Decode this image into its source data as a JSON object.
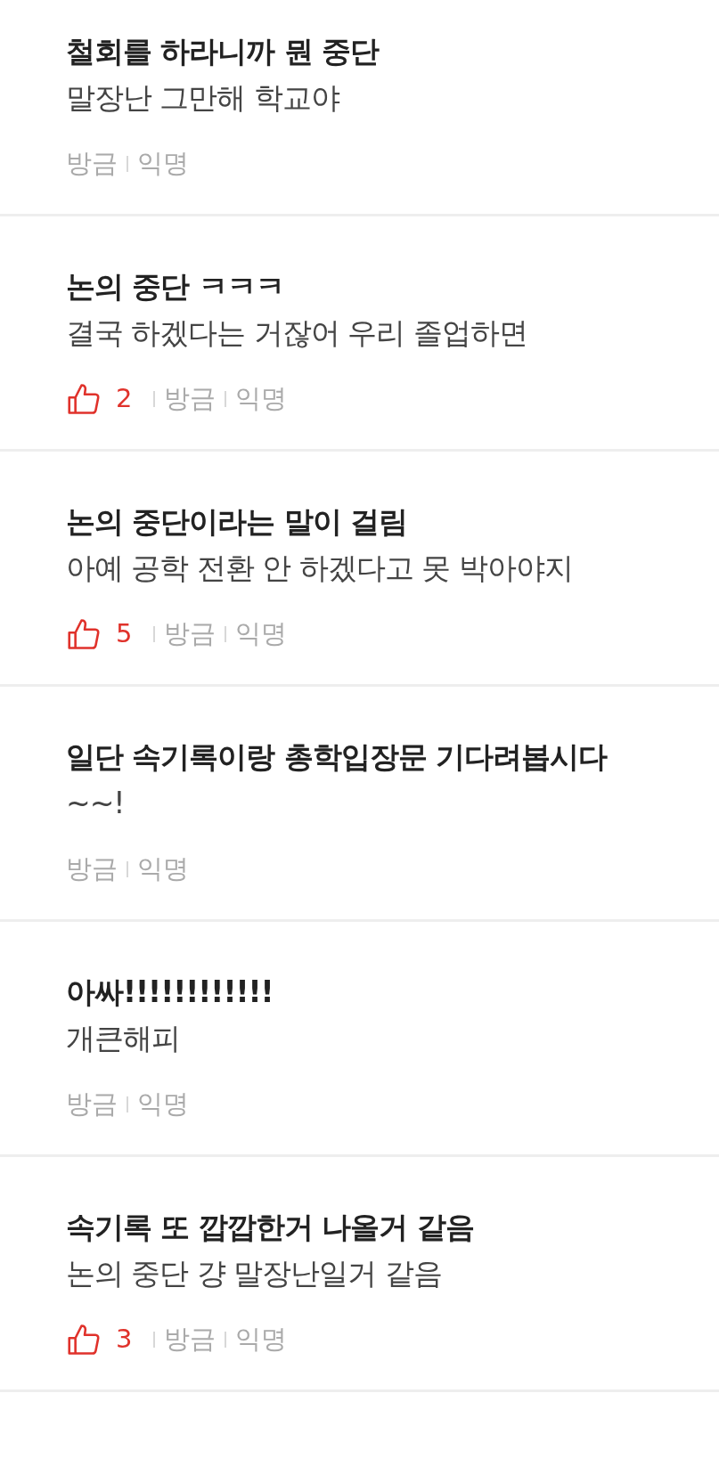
{
  "posts": [
    {
      "title": "철회를 하라니까 뭔 중단",
      "body": "말장난 그만해 학교야",
      "time": "방금",
      "author": "익명"
    },
    {
      "title": "논의 중단 ㅋㅋㅋ",
      "body": "결국 하겠다는 거잖어 우리 졸업하면",
      "likes": "2",
      "time": "방금",
      "author": "익명"
    },
    {
      "title": "논의 중단이라는 말이 걸림",
      "body": "아예 공학 전환 안 하겠다고 못 박아야지",
      "likes": "5",
      "time": "방금",
      "author": "익명"
    },
    {
      "title": "일단 속기록이랑 총학입장문 기다려봅시다",
      "body": "~~!",
      "time": "방금",
      "author": "익명"
    },
    {
      "title": "아싸!!!!!!!!!!!!",
      "body": "개큰해피",
      "time": "방금",
      "author": "익명"
    },
    {
      "title": "속기록 또 깝깝한거 나올거 같음",
      "body": "논의 중단 걍 말장난일거 같음",
      "likes": "3",
      "time": "방금",
      "author": "익명"
    }
  ]
}
